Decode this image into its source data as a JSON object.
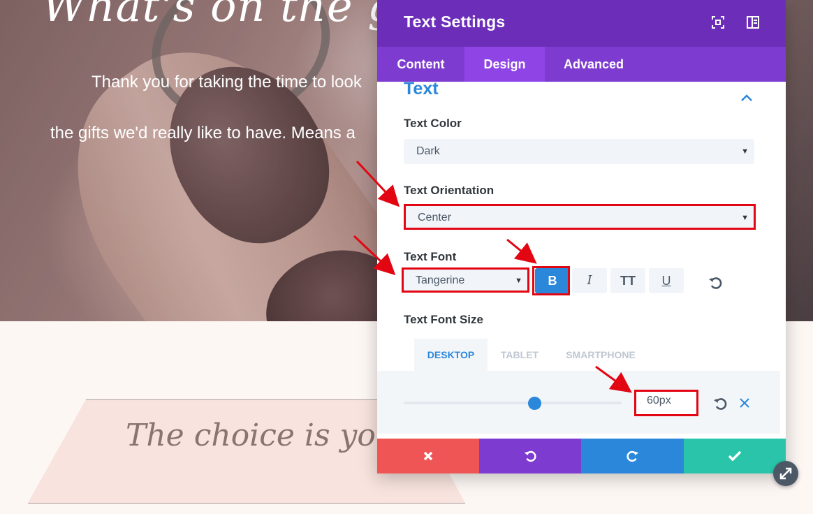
{
  "hero": {
    "title": "What's on the gift",
    "line1": "Thank you for taking the time to look",
    "line2": "the gifts we'd really like to have. Means a"
  },
  "banner": {
    "text": "The choice is yours"
  },
  "modal": {
    "title": "Text Settings",
    "header_icons": [
      "expand-icon",
      "split-view-icon"
    ],
    "tabs": [
      {
        "label": "Content",
        "active": false
      },
      {
        "label": "Design",
        "active": true
      },
      {
        "label": "Advanced",
        "active": false
      }
    ],
    "section": {
      "title": "Text",
      "expanded": true
    },
    "text_color": {
      "label": "Text Color",
      "value": "Dark"
    },
    "text_orientation": {
      "label": "Text Orientation",
      "value": "Center"
    },
    "text_font": {
      "label": "Text Font",
      "value": "Tangerine",
      "style_buttons": [
        {
          "label": "B",
          "active": true
        },
        {
          "label": "I",
          "active": false
        },
        {
          "label": "TT",
          "active": false
        },
        {
          "label": "U",
          "active": false
        }
      ]
    },
    "text_font_size": {
      "label": "Text Font Size",
      "device_tabs": [
        {
          "label": "DESKTOP",
          "active": true
        },
        {
          "label": "TABLET",
          "active": false
        },
        {
          "label": "SMARTPHONE",
          "active": false
        }
      ],
      "value": "60px",
      "slider_fraction": 0.6
    },
    "footer": [
      "discard",
      "undo",
      "redo",
      "save"
    ]
  },
  "colors": {
    "header": "#6c2eb9",
    "tabs": "#7e3bd0",
    "active_tab": "#8f44e6",
    "accent_blue": "#2b87da",
    "discard": "#ef5555",
    "save": "#29c4a9",
    "highlight_box": "#e20612"
  }
}
